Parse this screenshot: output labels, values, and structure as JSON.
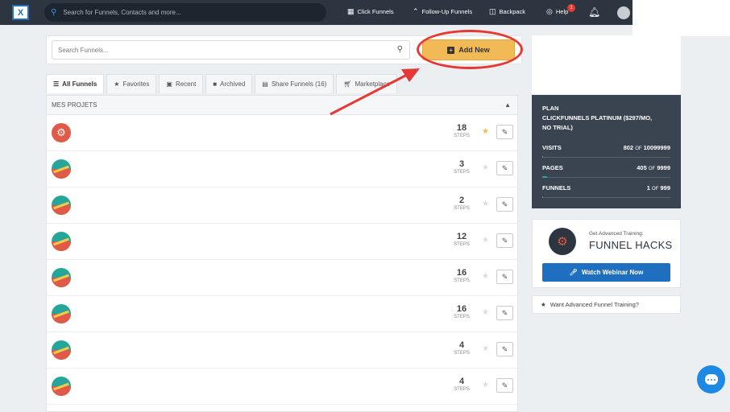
{
  "topbar": {
    "logo_text": "X",
    "search_placeholder": "Search for Funnels, Contacts and more...",
    "nav": [
      {
        "label": "Click Funnels",
        "icon": "funnels-icon"
      },
      {
        "label": "Follow-Up Funnels",
        "icon": "double-chevron-up-icon"
      },
      {
        "label": "Backpack",
        "icon": "backpack-icon"
      },
      {
        "label": "Help",
        "icon": "lifebuoy-icon"
      }
    ],
    "help_badge": "1"
  },
  "toolbar": {
    "search_placeholder": "Search Funnels...",
    "add_new_label": "Add New"
  },
  "tabs": [
    {
      "label": "All Funnels",
      "icon": "list-icon"
    },
    {
      "label": "Favorites",
      "icon": "star-icon"
    },
    {
      "label": "Recent",
      "icon": "calendar-icon"
    },
    {
      "label": "Archived",
      "icon": "archive-icon"
    },
    {
      "label": "Share Funnels (16)",
      "icon": "share-icon"
    },
    {
      "label": "Marketplace",
      "icon": "cart-icon"
    }
  ],
  "list": {
    "group_title": "MES PROJETS",
    "steps_label": "STEPS",
    "rows": [
      {
        "steps": "18",
        "favorite": true,
        "icon": "red"
      },
      {
        "steps": "3",
        "favorite": false,
        "icon": "teal"
      },
      {
        "steps": "2",
        "favorite": false,
        "icon": "teal"
      },
      {
        "steps": "12",
        "favorite": false,
        "icon": "teal"
      },
      {
        "steps": "16",
        "favorite": false,
        "icon": "teal"
      },
      {
        "steps": "16",
        "favorite": false,
        "icon": "teal"
      },
      {
        "steps": "4",
        "favorite": false,
        "icon": "teal"
      },
      {
        "steps": "4",
        "favorite": false,
        "icon": "teal"
      }
    ]
  },
  "plan": {
    "title_line1": "PLAN",
    "title_line2": "CLICKFUNNELS PLATINUM ($297/MO,",
    "title_line3": "NO TRIAL)",
    "stats": [
      {
        "label": "VISITS",
        "used": "802",
        "of": "OF",
        "max": "10099999",
        "fraction": 0.0001
      },
      {
        "label": "PAGES",
        "used": "405",
        "of": "OF",
        "max": "9999",
        "fraction": 0.04
      },
      {
        "label": "FUNNELS",
        "used": "1",
        "of": "OF",
        "max": "999",
        "fraction": 0.001
      }
    ]
  },
  "promo": {
    "pre_title": "Get Advanced Training:",
    "title": "FUNNEL HACKS",
    "button_label": "Watch Webinar Now"
  },
  "training_link": "Want Advanced Funnel Training?",
  "colors": {
    "nav_bg": "#2c3540",
    "accent": "#f2b957",
    "highlight": "#e53935",
    "primary": "#1e6fc0"
  }
}
